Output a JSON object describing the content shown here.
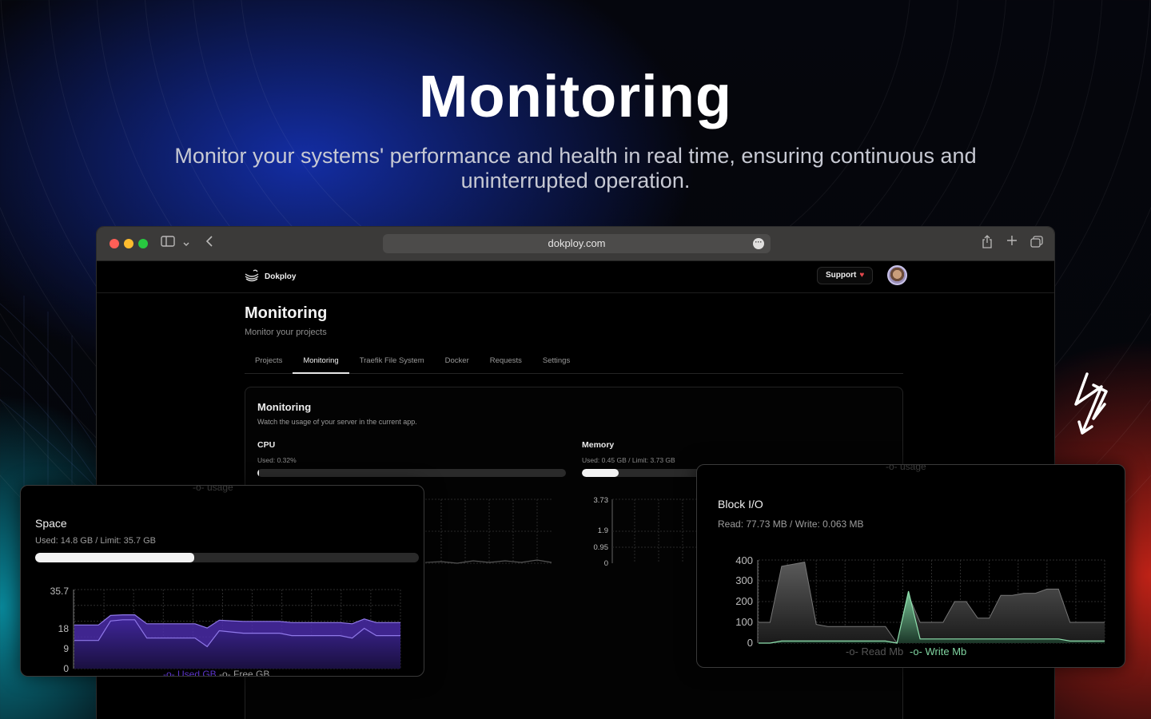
{
  "hero": {
    "title": "Monitoring",
    "subtitle": "Monitor your systems' performance and health in real time, ensuring continuous and uninterrupted operation."
  },
  "browser": {
    "url": "dokploy.com"
  },
  "app": {
    "logo_text": "Dokploy",
    "support_label": "Support",
    "page_title": "Monitoring",
    "page_description": "Monitor your projects",
    "tabs": [
      {
        "label": "Projects",
        "active": false
      },
      {
        "label": "Monitoring",
        "active": true
      },
      {
        "label": "Traefik File System",
        "active": false
      },
      {
        "label": "Docker",
        "active": false
      },
      {
        "label": "Requests",
        "active": false
      },
      {
        "label": "Settings",
        "active": false
      }
    ],
    "card": {
      "title": "Monitoring",
      "description": "Watch the usage of your server in the current app.",
      "cpu": {
        "label": "CPU",
        "used_text": "Used: 0.32%",
        "percent": 0.32
      },
      "memory": {
        "label": "Memory",
        "used_text": "Used: 0.45 GB / Limit: 3.73 GB",
        "fraction": 0.12
      },
      "legend_usage": "usage"
    }
  },
  "space_card": {
    "title": "Space",
    "used_text": "Used: 14.8 GB / Limit: 35.7 GB",
    "fraction": 0.415,
    "legend_used": "Used GB",
    "legend_free": "Free GB"
  },
  "blockio_card": {
    "title": "Block I/O",
    "sub_text": "Read: 77.73 MB / Write: 0.063 MB",
    "legend_read": "Read Mb",
    "legend_write": "Write Mb"
  },
  "colors": {
    "accent_purple": "#5b34c9",
    "accent_green": "#5fbf8a",
    "heart": "#e5484d"
  },
  "chart_data": [
    {
      "type": "area",
      "name_ref": "memory",
      "y_ticks": [
        "3.73",
        "1.9",
        "0.95",
        "0"
      ],
      "ylim": [
        0,
        3.73
      ]
    },
    {
      "type": "area",
      "name_ref": "space",
      "y_ticks": [
        "35.7",
        "18",
        "9",
        "0"
      ],
      "ylim": [
        0,
        35.7
      ],
      "series": [
        {
          "name": "Used GB",
          "values": [
            10,
            10,
            10,
            26,
            27,
            27,
            12,
            12,
            12,
            12,
            12,
            5,
            18,
            17,
            16,
            16,
            16,
            16,
            14,
            14,
            14,
            14,
            14,
            12,
            20,
            14,
            14,
            14
          ]
        },
        {
          "name": "Free GB",
          "values": [
            25,
            25,
            25,
            9,
            8,
            8,
            23,
            23,
            23,
            23,
            23,
            30,
            17,
            18,
            19,
            19,
            19,
            19,
            21,
            21,
            21,
            21,
            21,
            23,
            15,
            21,
            21,
            21
          ]
        }
      ]
    },
    {
      "type": "area",
      "name_ref": "block_io",
      "y_ticks": [
        "400",
        "300",
        "200",
        "100",
        "0"
      ],
      "ylim": [
        0,
        400
      ],
      "series": [
        {
          "name": "Read Mb",
          "values": [
            100,
            100,
            370,
            380,
            390,
            90,
            80,
            80,
            80,
            80,
            80,
            80,
            0,
            230,
            100,
            100,
            100,
            200,
            200,
            120,
            120,
            230,
            230,
            240,
            240,
            260,
            260,
            100,
            100,
            100,
            100
          ]
        },
        {
          "name": "Write Mb",
          "values": [
            0,
            0,
            10,
            10,
            10,
            10,
            10,
            10,
            10,
            10,
            10,
            10,
            0,
            250,
            20,
            20,
            20,
            20,
            20,
            20,
            20,
            20,
            20,
            20,
            20,
            20,
            20,
            10,
            10,
            10,
            10
          ]
        }
      ]
    }
  ]
}
